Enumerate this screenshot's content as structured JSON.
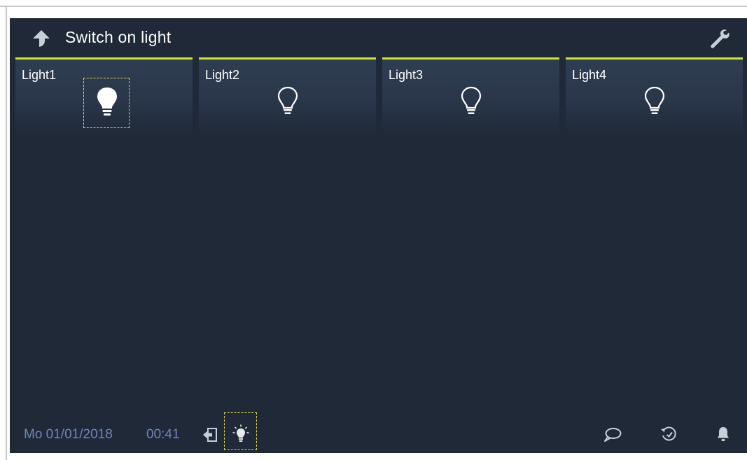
{
  "header": {
    "title": "Switch on light",
    "back_icon": "arrow-up-icon",
    "settings_icon": "wrench-icon"
  },
  "tiles": [
    {
      "label": "Light1",
      "state": "on",
      "selected": true,
      "icon": "bulb-on-icon"
    },
    {
      "label": "Light2",
      "state": "off",
      "selected": false,
      "icon": "bulb-off-icon"
    },
    {
      "label": "Light3",
      "state": "off",
      "selected": false,
      "icon": "bulb-off-icon"
    },
    {
      "label": "Light4",
      "state": "off",
      "selected": false,
      "icon": "bulb-off-icon"
    }
  ],
  "footer": {
    "date": "Mo 01/01/2018",
    "time": "00:41",
    "icons": [
      "exit-icon",
      "light-status-icon",
      "message-icon",
      "history-icon",
      "bell-icon"
    ]
  },
  "colors": {
    "background": "#1f2938",
    "accent": "#d4e236",
    "footer_text": "#6f86b8",
    "selection_outline": "#e7d94a"
  }
}
